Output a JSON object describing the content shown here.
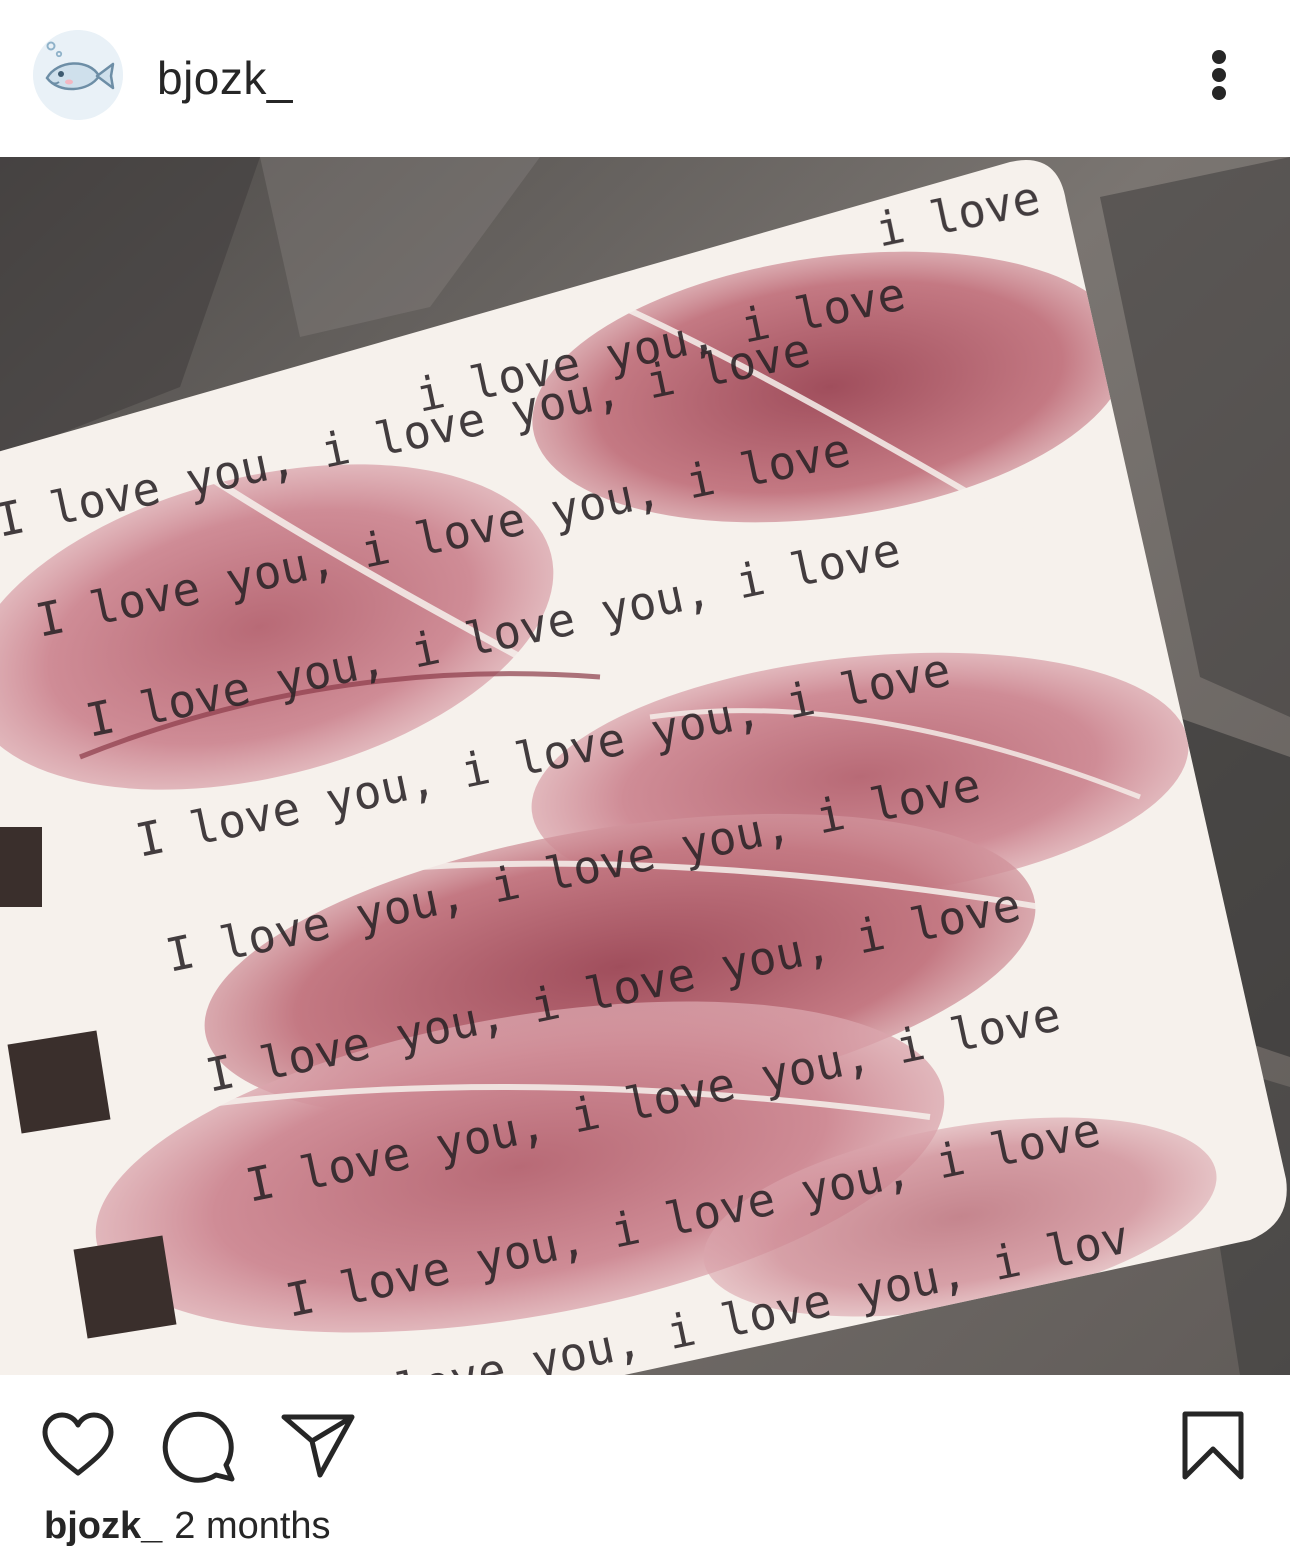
{
  "post": {
    "username": "bjozk_",
    "timestamp": "2 months"
  },
  "colors": {
    "text": "#262626",
    "background": "#ffffff",
    "avatar_bg": "#e9f1f7"
  },
  "icons": {
    "avatar": "fish-avatar-icon",
    "more": "more-vertical-icon",
    "like": "heart-icon",
    "comment": "comment-icon",
    "share": "paper-plane-icon",
    "save": "bookmark-icon"
  }
}
